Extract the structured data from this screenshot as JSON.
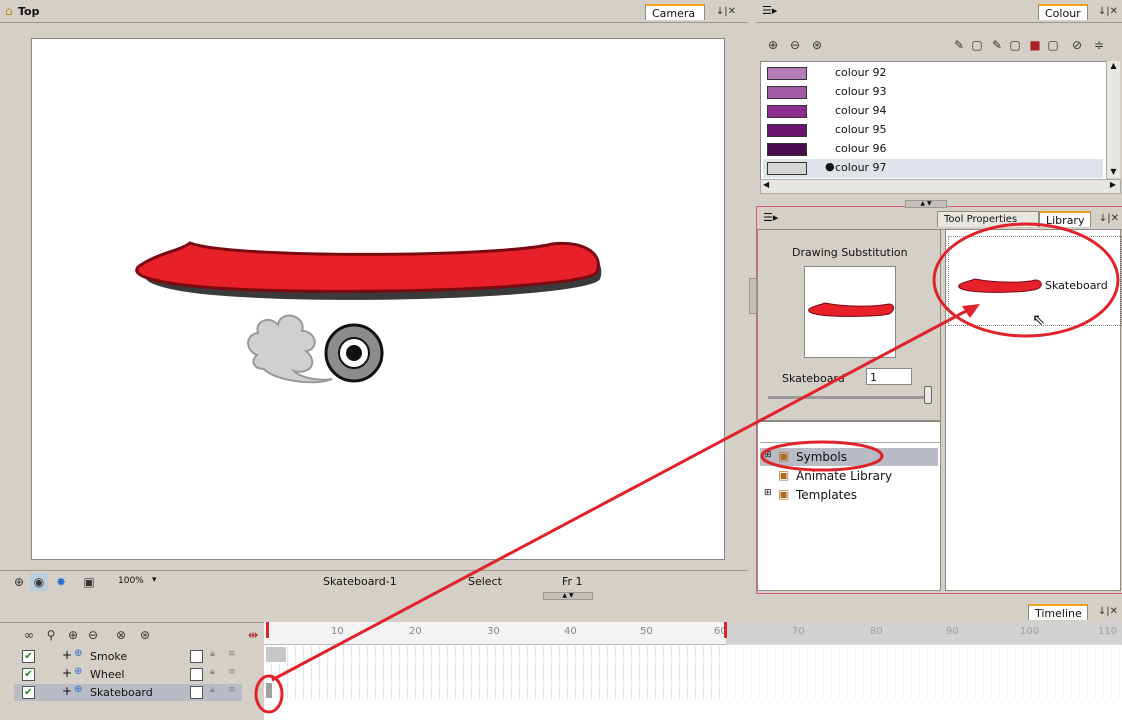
{
  "viewport": {
    "title": "Top",
    "tab_camera": "Camera",
    "status": {
      "zoom": "100%",
      "drawing": "Skateboard-1",
      "tool": "Select",
      "frame": "Fr 1"
    }
  },
  "colour_panel": {
    "tab": "Colour",
    "colours": [
      {
        "name": "colour 92",
        "hex": "#b57ab8",
        "selected": false
      },
      {
        "name": "colour 93",
        "hex": "#a05aa6",
        "selected": false
      },
      {
        "name": "colour 94",
        "hex": "#8a2d8e",
        "selected": false
      },
      {
        "name": "colour 95",
        "hex": "#6a1570",
        "selected": false
      },
      {
        "name": "colour 96",
        "hex": "#4a0a4e",
        "selected": false
      },
      {
        "name": "colour 97",
        "hex": "#d4d4d4",
        "selected": true
      }
    ]
  },
  "library_panel": {
    "tab_tool_properties": "Tool Properties",
    "tab_library": "Library",
    "drawing_substitution_label": "Drawing Substitution",
    "substitution_name": "Skateboard",
    "substitution_value": "1",
    "tree": [
      {
        "label": "Symbols",
        "expandable": true
      },
      {
        "label": "Animate Library",
        "expandable": false
      },
      {
        "label": "Templates",
        "expandable": true
      }
    ],
    "library_item": "Skateboard"
  },
  "timeline": {
    "tab": "Timeline",
    "layers": [
      {
        "name": "Smoke",
        "checked": true
      },
      {
        "name": "Wheel",
        "checked": true
      },
      {
        "name": "Skateboard",
        "checked": true
      }
    ],
    "ruler_marks": [
      "10",
      "20",
      "30",
      "40",
      "50",
      "60",
      "70",
      "80",
      "90",
      "100",
      "110"
    ]
  },
  "colors": {
    "skateboard_red": "#e8202a",
    "annotation_red": "#e0222a",
    "panel_bg": "#d4d0c8",
    "tab_accent": "#f0a020"
  }
}
